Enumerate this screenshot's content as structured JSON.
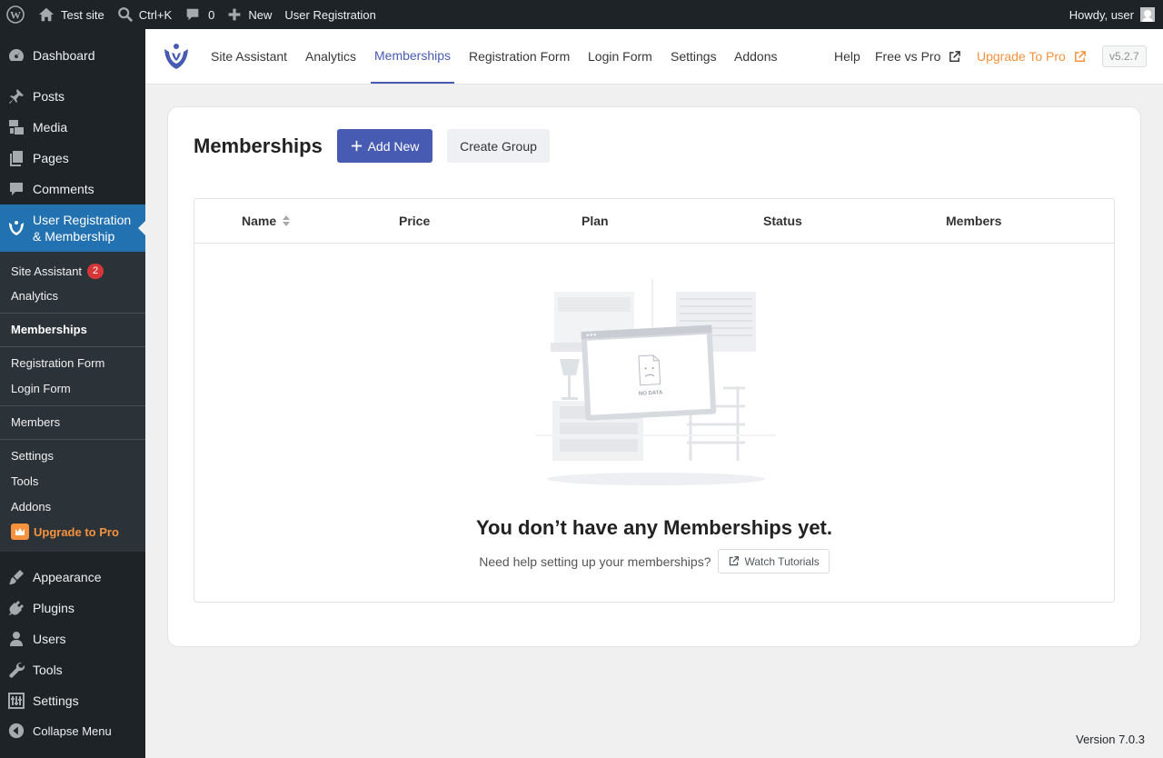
{
  "adminbar": {
    "site_name": "Test site",
    "search_shortcut": "Ctrl+K",
    "comments_count": "0",
    "new_label": "New",
    "plugin_label": "User Registration",
    "howdy": "Howdy, user"
  },
  "sidebar": {
    "items": [
      {
        "label": "Dashboard",
        "icon": "dashboard-icon"
      },
      {
        "label": "Posts",
        "icon": "pin-icon"
      },
      {
        "label": "Media",
        "icon": "media-icon"
      },
      {
        "label": "Pages",
        "icon": "pages-icon"
      },
      {
        "label": "Comments",
        "icon": "comment-icon"
      },
      {
        "label": "User Registration & Membership",
        "icon": "ur-logo-icon"
      },
      {
        "label": "Appearance",
        "icon": "brush-icon"
      },
      {
        "label": "Plugins",
        "icon": "plug-icon"
      },
      {
        "label": "Users",
        "icon": "user-icon"
      },
      {
        "label": "Tools",
        "icon": "wrench-icon"
      },
      {
        "label": "Settings",
        "icon": "sliders-icon"
      },
      {
        "label": "Collapse Menu",
        "icon": "collapse-icon"
      }
    ],
    "submenu": {
      "site_assistant": "Site Assistant",
      "site_assistant_badge": "2",
      "analytics": "Analytics",
      "memberships": "Memberships",
      "registration_form": "Registration Form",
      "login_form": "Login Form",
      "members": "Members",
      "settings": "Settings",
      "tools": "Tools",
      "addons": "Addons",
      "upgrade": "Upgrade to Pro"
    }
  },
  "topnav": {
    "tabs": [
      "Site Assistant",
      "Analytics",
      "Memberships",
      "Registration Form",
      "Login Form",
      "Settings",
      "Addons"
    ],
    "active_tab": "Memberships",
    "help": "Help",
    "free_vs_pro": "Free vs Pro",
    "upgrade": "Upgrade To Pro",
    "version": "v5.2.7"
  },
  "main": {
    "title": "Memberships",
    "add_new": "Add New",
    "create_group": "Create Group",
    "columns": [
      "Name",
      "Price",
      "Plan",
      "Status",
      "Members"
    ],
    "illustration_text": "NO DATA",
    "empty_title": "You don’t have any Memberships yet.",
    "empty_help": "Need help setting up your memberships?",
    "watch_tutorials": "Watch Tutorials"
  },
  "footer": {
    "version": "Version 7.0.3"
  },
  "colors": {
    "accent": "#475bb2",
    "wp_blue": "#2271b1",
    "orange": "#f6923e",
    "admin_dark": "#1d2327"
  }
}
